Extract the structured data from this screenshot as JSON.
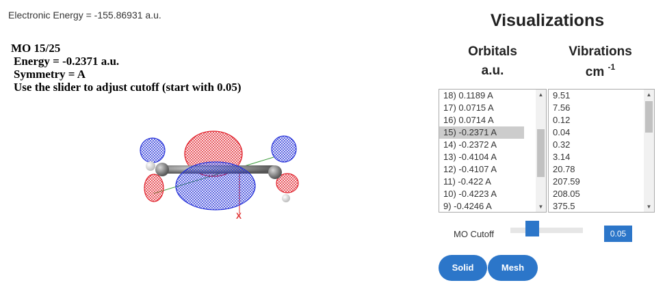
{
  "electronic_energy": "Electronic Energy = -155.86931 a.u.",
  "mo_info": {
    "title": "MO 15/25",
    "energy": "Energy = -0.2371 a.u.",
    "symmetry": "Symmetry = A",
    "instruction": "Use the slider to adjust cutoff (start with 0.05)"
  },
  "viewer": {
    "axis_label": "X",
    "colors": {
      "positive_lobe": "#e0202a",
      "negative_lobe": "#2430d8",
      "carbon": "#8a8a8a",
      "hydrogen": "#ffffff"
    }
  },
  "visualizations": {
    "title": "Visualizations",
    "orbitals_header": "Orbitals",
    "orbitals_unit": "a.u.",
    "vibrations_header": "Vibrations",
    "vibrations_unit_base": "cm",
    "vibrations_unit_exp": "-1"
  },
  "orbitals_list": [
    "18) 0.1189 A",
    "17) 0.0715 A",
    "16) 0.0714 A",
    "15) -0.2371 A",
    "14) -0.2372 A",
    "13) -0.4104 A",
    "12) -0.4107 A",
    "11) -0.422 A",
    "10) -0.4223 A",
    "9) -0.4246 A"
  ],
  "orbitals_selected": "15) -0.2371 A",
  "vibrations_list": [
    "9.51",
    "7.56",
    "0.12",
    "0.04",
    "0.32",
    "3.14",
    "20.78",
    "207.59",
    "208.05",
    "375.5"
  ],
  "cutoff": {
    "label": "MO Cutoff",
    "value": "0.05",
    "slider_fraction": 0.25
  },
  "buttons": {
    "solid": "Solid",
    "mesh": "Mesh"
  },
  "accent_color": "#2c76c9"
}
